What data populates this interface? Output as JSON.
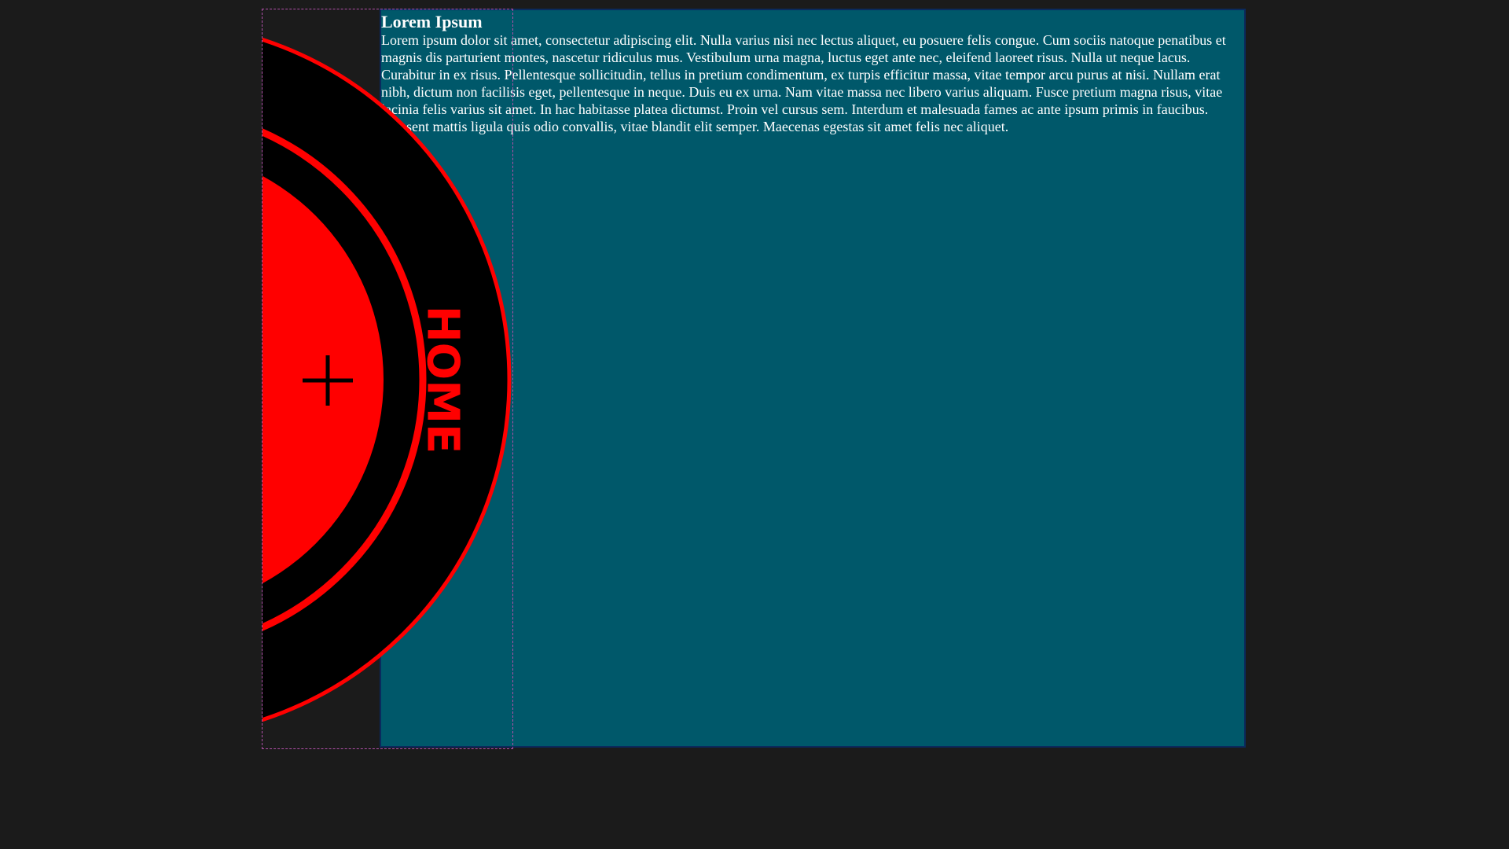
{
  "content": {
    "title": "Lorem Ipsum",
    "body": "Lorem ipsum dolor sit amet, consectetur adipiscing elit. Nulla varius nisi nec lectus aliquet, eu posuere felis congue. Cum sociis natoque penatibus et magnis dis parturient montes, nascetur ridiculus mus. Vestibulum urna magna, luctus eget ante nec, eleifend laoreet risus. Nulla ut neque lacus. Curabitur in ex risus. Pellentesque sollicitudin, tellus in pretium condimentum, ex turpis efficitur massa, vitae tempor arcu purus at nisi. Nullam erat nibh, dictum non facilisis eget, pellentesque in neque. Duis eu ex urna. Nam vitae massa nec libero varius aliquam. Fusce pretium magna risus, vitae lacinia felis varius sit amet. In hac habitasse platea dictumst. Proin vel cursus sem. Interdum et malesuada fames ac ante ipsum primis in faucibus. Praesent mattis ligula quis odio convallis, vitae blandit elit semper. Maecenas egestas sit amet felis nec aliquet."
  },
  "menu": {
    "label": "HOME",
    "center_icon": "plus-icon"
  },
  "colors": {
    "page_background": "#1b1b1b",
    "content_background": "#00586a",
    "content_border": "#0a2a5e",
    "menu_accent": "#ff0000",
    "menu_ring": "#000000",
    "widget_outline": "#b04fa8",
    "text": "#ffffff"
  }
}
